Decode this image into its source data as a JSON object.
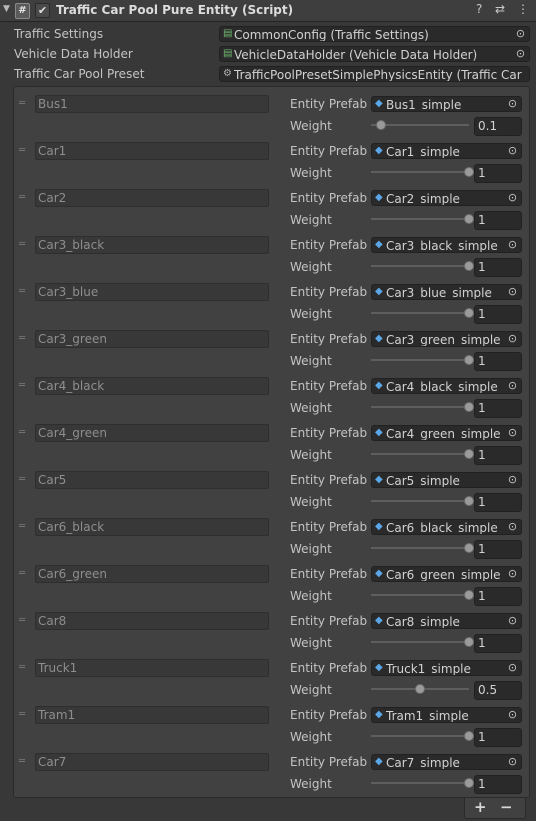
{
  "component": {
    "title": "Traffic Car Pool Pure Entity (Script)",
    "enabled": "✔",
    "fold_icon": "▼",
    "script_icon": "#"
  },
  "header_icons": {
    "help": "?",
    "preset": "⇄",
    "menu": "⋮"
  },
  "fields": [
    {
      "label": "Traffic Settings",
      "value": "CommonConfig (Traffic Settings)",
      "icon": "script-asset-icon"
    },
    {
      "label": "Vehicle Data Holder",
      "value": "VehicleDataHolder (Vehicle Data Holder)",
      "icon": "script-asset-icon"
    },
    {
      "label": "Traffic Car Pool Preset",
      "value": "TrafficPoolPresetSimplePhysicsEntity (Traffic Car",
      "icon": "preset-asset-icon"
    }
  ],
  "labels": {
    "entity_prefab": "Entity Prefab",
    "weight": "Weight"
  },
  "entries": [
    {
      "name": "Bus1",
      "prefab": "Bus1_simple",
      "weight": "0.1",
      "level": 0.1
    },
    {
      "name": "Car1",
      "prefab": "Car1_simple",
      "weight": "1",
      "level": 1
    },
    {
      "name": "Car2",
      "prefab": "Car2_simple",
      "weight": "1",
      "level": 1
    },
    {
      "name": "Car3_black",
      "prefab": "Car3_black_simple",
      "weight": "1",
      "level": 1
    },
    {
      "name": "Car3_blue",
      "prefab": "Car3_blue_simple",
      "weight": "1",
      "level": 1
    },
    {
      "name": "Car3_green",
      "prefab": "Car3_green_simple",
      "weight": "1",
      "level": 1
    },
    {
      "name": "Car4_black",
      "prefab": "Car4_black_simple",
      "weight": "1",
      "level": 1
    },
    {
      "name": "Car4_green",
      "prefab": "Car4_green_simple",
      "weight": "1",
      "level": 1
    },
    {
      "name": "Car5",
      "prefab": "Car5_simple",
      "weight": "1",
      "level": 1
    },
    {
      "name": "Car6_black",
      "prefab": "Car6_black_simple",
      "weight": "1",
      "level": 1
    },
    {
      "name": "Car6_green",
      "prefab": "Car6_green_simple",
      "weight": "1",
      "level": 1
    },
    {
      "name": "Car8",
      "prefab": "Car8_simple",
      "weight": "1",
      "level": 1
    },
    {
      "name": "Truck1",
      "prefab": "Truck1_simple",
      "weight": "0.5",
      "level": 0.5
    },
    {
      "name": "Tram1",
      "prefab": "Tram1_simple",
      "weight": "1",
      "level": 1
    },
    {
      "name": "Car7",
      "prefab": "Car7_simple",
      "weight": "1",
      "level": 1
    }
  ],
  "list_buttons": {
    "add": "+",
    "remove": "−"
  },
  "colors": {
    "background": "#383838",
    "header": "#3e3e3e",
    "field": "#2a2a2a",
    "prefab_icon": "#5ba6e6",
    "script_icon": "#6fb86f"
  }
}
